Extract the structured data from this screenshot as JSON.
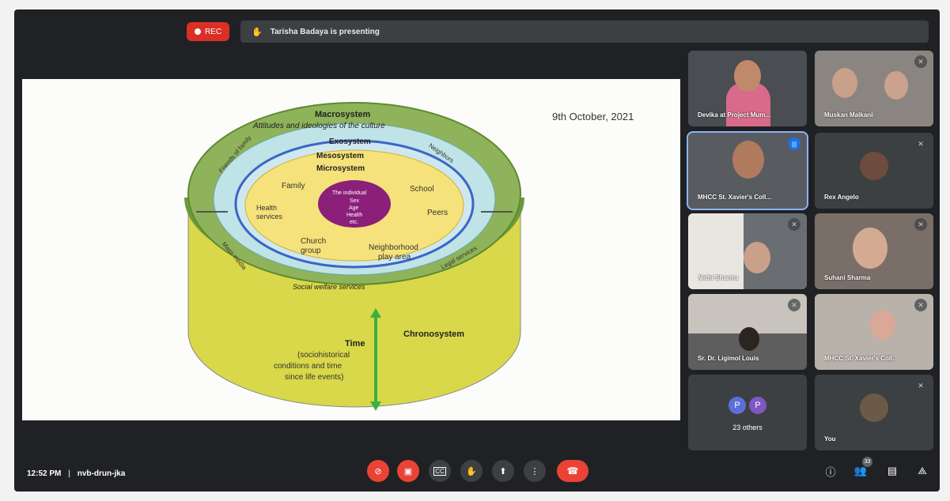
{
  "topbar": {
    "rec_label": "REC",
    "presenting_text": "Tarisha Badaya is presenting"
  },
  "slide": {
    "date": "9th October, 2021",
    "diagram": {
      "macrosystem": "Macrosystem",
      "macro_sub": "Attitudes and ideologies of the culture",
      "exosystem": "Exosystem",
      "mesosystem": "Mesosystem",
      "microsystem": "Microsystem",
      "friends": "Friends of family",
      "neighbors": "Neighbors",
      "mass_media": "Mass media",
      "legal_services": "Legal services",
      "social_welfare": "Social welfare services",
      "family": "Family",
      "school": "School",
      "health_services_1": "Health",
      "health_services_2": "services",
      "peers": "Peers",
      "church_1": "Church",
      "church_2": "group",
      "play_area_1": "Neighborhood",
      "play_area_2": "play area",
      "individual_1": "The individual",
      "individual_2": "Sex",
      "individual_3": "Age",
      "individual_4": "Health",
      "individual_5": "etc.",
      "chronosystem": "Chronosystem",
      "time": "Time",
      "time_sub_1": "(sociohistorical",
      "time_sub_2": "conditions and time",
      "time_sub_3": "since life events)"
    }
  },
  "participants": [
    {
      "name": "Devika at Project Mum...",
      "muted": false
    },
    {
      "name": "Muskan Malkani",
      "muted": true
    },
    {
      "name": "MHCC St. Xavier's Coll...",
      "muted": false,
      "speaking": true
    },
    {
      "name": "Rex Angelo",
      "muted": true
    },
    {
      "name": "Nidhi Sharma",
      "muted": true
    },
    {
      "name": "Suhani Sharma",
      "muted": true
    },
    {
      "name": "Sr. Dr. Ligimol Louis",
      "muted": true
    },
    {
      "name": "MHCC St. Xavier's Coll...",
      "muted": true
    },
    {
      "name": "23 others",
      "avatars": [
        "P",
        "P"
      ]
    },
    {
      "name": "You",
      "muted": true
    }
  ],
  "bottombar": {
    "time": "12:52 PM",
    "separator": "|",
    "meeting_code": "nvb-drun-jka",
    "people_count": "33"
  },
  "colors": {
    "rec": "#d93025",
    "leave": "#ea4335",
    "tile_bg": "#3c4043",
    "avatar_p": "#7e57c2"
  },
  "icons": {
    "mic": "mic-off-icon",
    "camera": "camera-off-icon",
    "captions": "captions-icon",
    "hand": "raise-hand-icon",
    "present": "present-screen-icon",
    "more": "more-options-icon",
    "leave": "leave-call-icon",
    "info": "info-icon",
    "people": "people-icon",
    "chat": "chat-icon",
    "activities": "activities-icon"
  }
}
